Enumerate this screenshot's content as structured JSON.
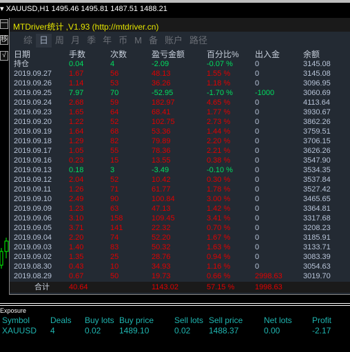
{
  "chart": {
    "label": "XAUUSD,H1  1495.46 1495.81 1487.51 1488.21",
    "side_buttons": [
      "一",
      "移",
      "√"
    ]
  },
  "panel": {
    "title": "MTDriver统计 ,V1.93 (http://mtdriver.cn)",
    "tabs": [
      {
        "label": "综"
      },
      {
        "label": "日",
        "active": true
      },
      {
        "label": "周"
      },
      {
        "label": "月"
      },
      {
        "label": "季"
      },
      {
        "label": "年"
      },
      {
        "label": "币"
      },
      {
        "label": "M"
      },
      {
        "label": "备"
      },
      {
        "label": "账户"
      },
      {
        "label": "路径"
      }
    ],
    "columns": [
      "日期",
      "手数",
      "次数",
      "盈亏金额",
      "百分比%",
      "出入金",
      "余额"
    ],
    "open": {
      "label": "持仓",
      "lots": "0.04",
      "count": "4",
      "pl": "-2.09",
      "pct": "-0.07 %",
      "flow": "0",
      "balance": "3145.08"
    },
    "rows": [
      [
        "2019.09.27",
        "1.67",
        "56",
        "48.13",
        "1.55 %",
        "0",
        "3145.08"
      ],
      [
        "2019.09.26",
        "1.14",
        "53",
        "36.26",
        "1.18 %",
        "0",
        "3096.95"
      ],
      [
        "2019.09.25",
        "7.97",
        "70",
        "-52.95",
        "-1.70 %",
        "-1000",
        "3060.69"
      ],
      [
        "2019.09.24",
        "2.68",
        "59",
        "182.97",
        "4.65 %",
        "0",
        "4113.64"
      ],
      [
        "2019.09.23",
        "1.65",
        "64",
        "68.41",
        "1.77 %",
        "0",
        "3930.67"
      ],
      [
        "2019.09.20",
        "1.22",
        "52",
        "102.75",
        "2.73 %",
        "0",
        "3862.26"
      ],
      [
        "2019.09.19",
        "1.64",
        "68",
        "53.36",
        "1.44 %",
        "0",
        "3759.51"
      ],
      [
        "2019.09.18",
        "1.29",
        "82",
        "79.89",
        "2.20 %",
        "0",
        "3706.15"
      ],
      [
        "2019.09.17",
        "1.05",
        "55",
        "78.36",
        "2.21 %",
        "0",
        "3626.26"
      ],
      [
        "2019.09.16",
        "0.23",
        "15",
        "13.55",
        "0.38 %",
        "0",
        "3547.90"
      ],
      [
        "2019.09.13",
        "0.18",
        "3",
        "-3.49",
        "-0.10 %",
        "0",
        "3534.35"
      ],
      [
        "2019.09.12",
        "2.04",
        "52",
        "10.42",
        "0.30 %",
        "0",
        "3537.84"
      ],
      [
        "2019.09.11",
        "1.26",
        "71",
        "61.77",
        "1.78 %",
        "0",
        "3527.42"
      ],
      [
        "2019.09.10",
        "2.49",
        "90",
        "100.84",
        "3.00 %",
        "0",
        "3465.65"
      ],
      [
        "2019.09.09",
        "1.23",
        "63",
        "47.13",
        "1.42 %",
        "0",
        "3364.81"
      ],
      [
        "2019.09.06",
        "3.10",
        "158",
        "109.45",
        "3.41 %",
        "0",
        "3317.68"
      ],
      [
        "2019.09.05",
        "3.71",
        "141",
        "22.32",
        "0.70 %",
        "0",
        "3208.23"
      ],
      [
        "2019.09.04",
        "2.20",
        "74",
        "52.20",
        "1.67 %",
        "0",
        "3185.91"
      ],
      [
        "2019.09.03",
        "1.40",
        "83",
        "50.32",
        "1.63 %",
        "0",
        "3133.71"
      ],
      [
        "2019.09.02",
        "1.35",
        "25",
        "28.76",
        "0.94 %",
        "0",
        "3083.39"
      ],
      [
        "2019.08.30",
        "0.43",
        "10",
        "34.93",
        "1.16 %",
        "0",
        "3054.63"
      ],
      [
        "2019.08.29",
        "0.67",
        "50",
        "19.73",
        "0.66 %",
        "2998.63",
        "3019.70"
      ]
    ],
    "total": {
      "label": "合计",
      "lots": "40.64",
      "pl": "1143.02",
      "pct": "57.15 %",
      "flow": "1998.63"
    },
    "colors": {
      "profit": "#e00000",
      "loss": "#00e060",
      "text": "#b8c4d8",
      "title": "#e6e600"
    }
  },
  "exposure": {
    "title": "Exposure",
    "headers": [
      "Symbol",
      "Deals",
      "Buy lots",
      "Buy price",
      "Sell lots",
      "Sell price",
      "Net lots",
      "Profit"
    ],
    "row": [
      "XAUUSD",
      "4",
      "0.02",
      "1489.10",
      "0.02",
      "1488.37",
      "0.00",
      "-2.17"
    ]
  }
}
